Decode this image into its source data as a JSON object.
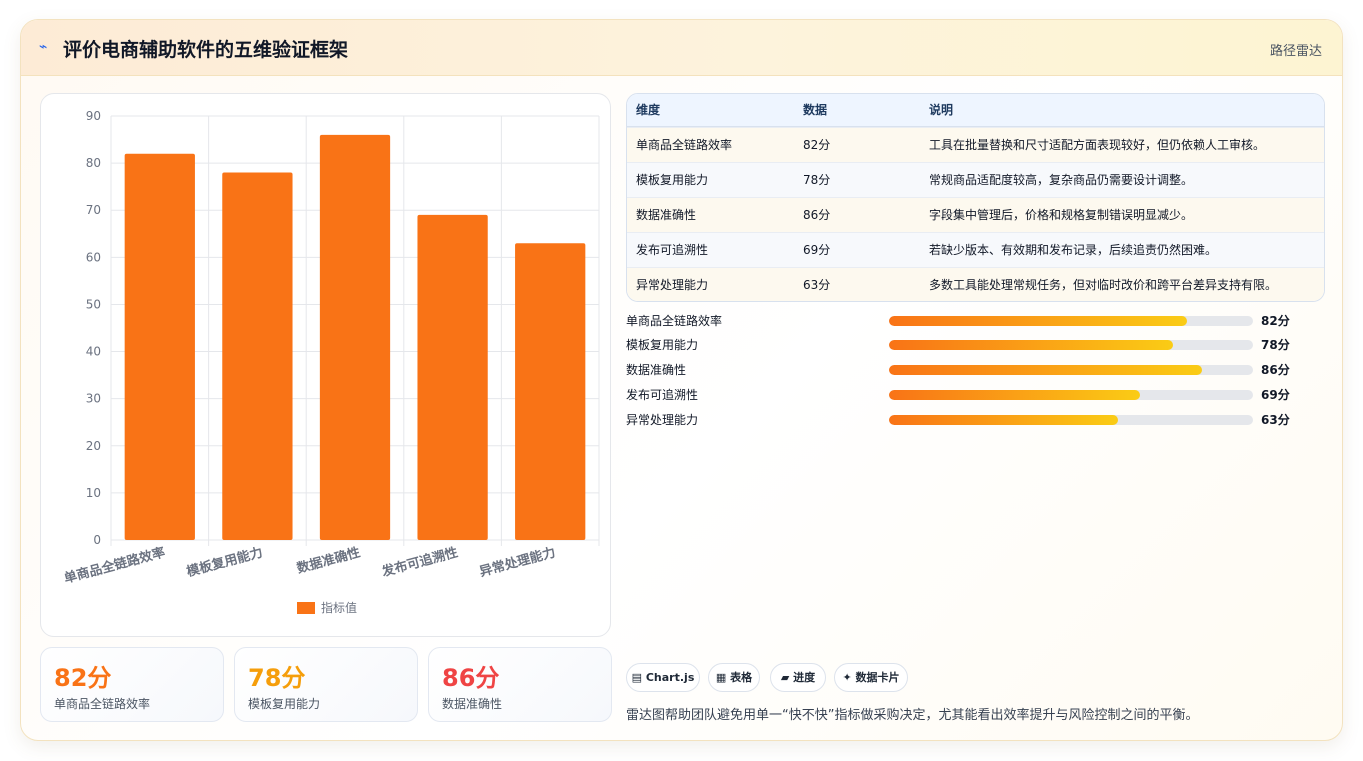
{
  "header": {
    "icon": "lightning-icon",
    "title": "评价电商辅助软件的五维验证框架",
    "badge": "路径雷达"
  },
  "chart_data": {
    "type": "bar",
    "categories": [
      "单商品全链路效率",
      "模板复用能力",
      "数据准确性",
      "发布可追溯性",
      "异常处理能力"
    ],
    "series": [
      {
        "name": "指标值",
        "values": [
          82,
          78,
          86,
          69,
          63
        ]
      }
    ],
    "ylim": [
      0,
      90
    ],
    "yticks": [
      0,
      10,
      20,
      30,
      40,
      50,
      60,
      70,
      80,
      90
    ],
    "grid": true,
    "legend": "bottom",
    "color": "#f97316"
  },
  "kpis": [
    {
      "value": "82分",
      "label": "单商品全链路效率",
      "color": "#f97316"
    },
    {
      "value": "78分",
      "label": "模板复用能力",
      "color": "#f59e0b"
    },
    {
      "value": "86分",
      "label": "数据准确性",
      "color": "#ef4444"
    }
  ],
  "table": {
    "headers": [
      "维度",
      "数据",
      "说明"
    ],
    "rows": [
      [
        "单商品全链路效率",
        "82分",
        "工具在批量替换和尺寸适配方面表现较好，但仍依赖人工审核。"
      ],
      [
        "模板复用能力",
        "78分",
        "常规商品适配度较高，复杂商品仍需要设计调整。"
      ],
      [
        "数据准确性",
        "86分",
        "字段集中管理后，价格和规格复制错误明显减少。"
      ],
      [
        "发布可追溯性",
        "69分",
        "若缺少版本、有效期和发布记录，后续追责仍然困难。"
      ],
      [
        "异常处理能力",
        "63分",
        "多数工具能处理常规任务，但对临时改价和跨平台差异支持有限。"
      ]
    ]
  },
  "progress": [
    {
      "label": "单商品全链路效率",
      "value": 82,
      "text": "82分"
    },
    {
      "label": "模板复用能力",
      "value": 78,
      "text": "78分"
    },
    {
      "label": "数据准确性",
      "value": 86,
      "text": "86分"
    },
    {
      "label": "发布可追溯性",
      "value": 69,
      "text": "69分"
    },
    {
      "label": "异常处理能力",
      "value": 63,
      "text": "63分"
    }
  ],
  "progress_max": 100,
  "chips": [
    {
      "icon": "chart-icon",
      "label": "Chart.js"
    },
    {
      "icon": "table-icon",
      "label": "表格"
    },
    {
      "icon": "progress-icon",
      "label": "进度"
    },
    {
      "icon": "sparkle-icon",
      "label": "数据卡片"
    }
  ],
  "footer_note": "雷达图帮助团队避免用单一“快不快”指标做采购决定，尤其能看出效率提升与风险控制之间的平衡。"
}
